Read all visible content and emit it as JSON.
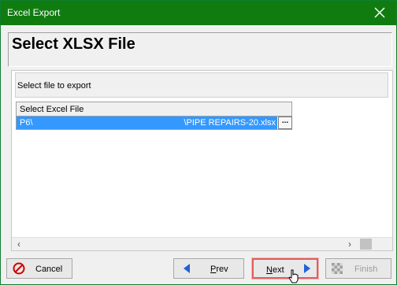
{
  "window": {
    "title": "Excel Export"
  },
  "page": {
    "heading": "Select XLSX File",
    "instruction": "Select file to export"
  },
  "grid": {
    "column_header": "Select Excel File",
    "path_left": "P6\\",
    "path_right": "\\PIPE REPAIRS-20.xlsx",
    "browse_label": "..."
  },
  "footer": {
    "cancel": "Cancel",
    "prev_prefix": "P",
    "prev_rest": "rev",
    "next_prefix": "N",
    "next_rest": "ext",
    "finish": "Finish"
  },
  "icons": {
    "close": "close-icon",
    "cancel": "stop-icon",
    "prev": "left-arrow-icon",
    "next": "right-arrow-icon",
    "finish": "checkered-flag-icon",
    "cursor": "hand-pointer-icon"
  },
  "colors": {
    "title_bar": "#107c10",
    "selection": "#3399ff",
    "highlight": "#e45b5b"
  }
}
